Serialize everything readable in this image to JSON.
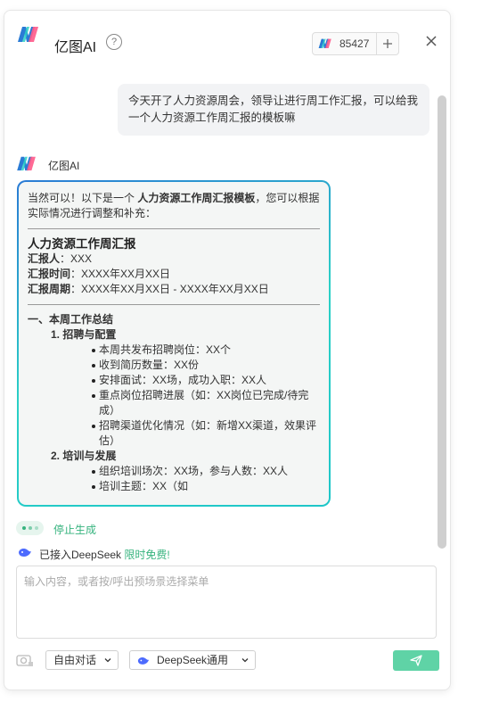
{
  "header": {
    "title": "亿图AI",
    "help_icon": "help-icon",
    "credits": "85427",
    "add_icon": "plus-icon",
    "close_icon": "close-icon"
  },
  "conversation": {
    "user_message": "今天开了人力资源周会，领导让进行周工作汇报，可以给我一个人力资源工作周汇报的模板嘛",
    "ai_name": "亿图AI",
    "ai_intro_prefix": "当然可以！以下是一个 ",
    "ai_intro_bold": "人力资源工作周汇报模板",
    "ai_intro_suffix": "，您可以根据实际情况进行调整和补充：",
    "doc_title": "人力资源工作周汇报",
    "meta": [
      {
        "label": "汇报人",
        "value": "：XXX"
      },
      {
        "label": "汇报时间",
        "value": "：XXXX年XX月XX日"
      },
      {
        "label": "汇报周期",
        "value": "：XXXX年XX月XX日 - XXXX年XX月XX日"
      }
    ],
    "section1_title": "一、本周工作总结",
    "sub1_title": "1. 招聘与配置",
    "sub1_items": [
      "本周共发布招聘岗位：XX个",
      "收到简历数量：XX份",
      "安排面试：XX场，成功入职：XX人",
      "重点岗位招聘进展（如：XX岗位已完成/待完成）",
      "招聘渠道优化情况（如：新增XX渠道，效果评估）"
    ],
    "sub2_title": "2. 培训与发展",
    "sub2_items": [
      "组织培训场次：XX场，参与人数：XX人",
      "培训主题：XX（如"
    ]
  },
  "generation": {
    "stop_label": "停止生成"
  },
  "deepseek": {
    "status": "已接入DeepSeek",
    "free": "限时免费!"
  },
  "input": {
    "placeholder": "输入内容，或者按/呼出预场景选择菜单",
    "value": ""
  },
  "toolbar": {
    "mode": "自由对话",
    "model": "DeepSeek通用",
    "send_icon": "send-icon"
  },
  "colors": {
    "accent_green": "#36b37e",
    "send_button": "#5fd3a6",
    "card_border_start": "#2a7bd5",
    "card_border_end": "#1ec6c8"
  }
}
